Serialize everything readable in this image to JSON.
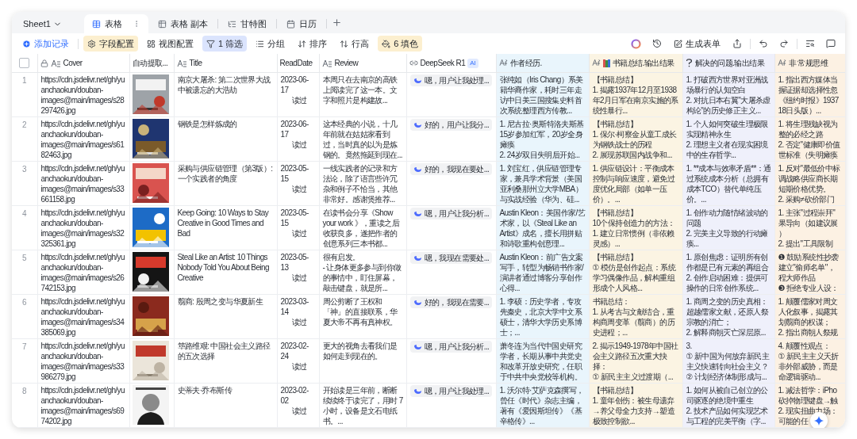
{
  "sheet": {
    "name": "Sheet1"
  },
  "tabs": [
    {
      "label": "表格",
      "selected": true
    },
    {
      "label": "表格 副本",
      "selected": false
    },
    {
      "label": "甘特图",
      "selected": false
    },
    {
      "label": "日历",
      "selected": false
    }
  ],
  "toolbar": [
    {
      "label": "添加记录",
      "kind": "primary"
    },
    {
      "label": "字段配置",
      "kind": "warm"
    },
    {
      "label": "视图配置",
      "kind": "plain"
    },
    {
      "label": "1 筛选",
      "kind": "cool"
    },
    {
      "label": "分组",
      "kind": "plain"
    },
    {
      "label": "排序",
      "kind": "plain"
    },
    {
      "label": "行高",
      "kind": "plain"
    },
    {
      "label": "6 填色",
      "kind": "warm"
    }
  ],
  "generate_form": {
    "label": "生成表单"
  },
  "table": {
    "header_checkbox": {
      "checked": false
    },
    "columns": [
      {
        "label": "Cover",
        "kind": "locked-text",
        "color": "#ffffff"
      },
      {
        "label": "自动提取...",
        "kind": "plain",
        "color": "#ffffff"
      },
      {
        "label": "Title",
        "kind": "text",
        "color": "#ffffff"
      },
      {
        "label": "ReadDate",
        "kind": "plain",
        "color": "#ffffff"
      },
      {
        "label": "Review",
        "kind": "text",
        "color": "#ffffff"
      },
      {
        "label": "DeepSeek  R1",
        "kind": "link",
        "badge": "AI",
        "color": "#ffffff"
      },
      {
        "label": "作者经历.",
        "kind": "ai-text",
        "color": "#e9f5fc"
      },
      {
        "label": "书籍总结.输出结果",
        "kind": "ai-book",
        "color": "#fbf4e3"
      },
      {
        "label": "解决的问题.输出结果",
        "kind": "question",
        "color": "#eff0fb"
      },
      {
        "label": "非 常规思维",
        "kind": "ai-text",
        "color": "#fcf1e3"
      }
    ],
    "rows": [
      {
        "number": "1",
        "cover_url": "https://cdn.jsdelivr.net/gh/yuanchaokun/douban-images@main/images/s28297426.jpg",
        "title": "南京大屠杀: 第二次世界大战中被遗忘的大浩劫",
        "read_date": "2023-06-17",
        "status": "读过",
        "review": "本周只在去南京的高铁上阅读完了这一本。文字和照片是构建故...",
        "deepseek": "嗯，用户让我处理...",
        "author": "张纯如（Iris Chang）系美籍华裔作家，耗时三年走访中日美三国搜集史料首次系统整理西方传教...",
        "summary": "【书籍总结】\n1. 揭露1937年12月至1938年2月日军在南京实施的系统性暴行...",
        "problems": "1. 打破西方世界对亚洲战场暴行的认知空白\n2. 对抗日本右翼\"大屠杀虚构论\"的历史修正主义...",
        "unusual": [
          "1. 指出西方媒体当",
          "握证据却选择性忽",
          "《纽约时报》1937",
          "18日头版）..."
        ]
      },
      {
        "number": "2",
        "cover_url": "https://cdn.jsdelivr.net/gh/yuanchaokun/douban-images@main/images/s6182463.jpg",
        "title": "钢铁是怎样炼成的",
        "read_date": "2023-06-17",
        "status": "读过",
        "review": "这本经典的小说，十几年前就在姑姑家看到过，当时真的以为是炼钢的。竟然拖延到现在...",
        "deepseek": "好的，用户让我分...",
        "author": "1. 尼古拉·奥斯特洛夫斯基15岁参加红军，20岁全身瘫痪\n2. 24岁双目失明后开始...",
        "summary": "【书籍总结】\n1. 保尔·柯察金从童工成长为钢铁战士的历程\n2. 展现苏联国内战争和...",
        "problems": "1. 个人如何突破生理极限实现精神永生\n2. 理想主义者在现实困境中的生存哲学...",
        "unusual": [
          "1. 将生理残缺视为",
          "整的必经之路",
          "2. 否定\"健康即价值",
          "世标准（失明瘫痪"
        ]
      },
      {
        "number": "3",
        "cover_url": "https://cdn.jsdelivr.net/gh/yuanchaokun/douban-images@main/images/s33661158.jpg",
        "title": "采购与供应链管理（第3版）:一个实践者的角度",
        "read_date": "2023-05-15",
        "status": "读过",
        "review": "一线实践者的记录和方法论，除了语言些许冗杂和例子不恰当，其他非常好。感谢煲推荐...",
        "deepseek": "好的，我现在要处...",
        "author": "1. 刘宝红，供应链管理专家，兼具学术背景（美国亚利桑那州立大学MBA）与实战经验（华为、硅...",
        "summary": "1. 供应链设计：平衡成本控制与响应速度，避免过度优化局部（如单一压价）。...",
        "problems": "1. **成本与效率矛盾**：通过系统成本分析（总拥有成本TCO）替代单纯压价。...",
        "unusual": [
          "1. 反对\"最低价中标",
          "调战略供应商长期",
          "短期价格优势。",
          "2. 采购≠砍价部门"
        ]
      },
      {
        "number": "4",
        "cover_url": "https://cdn.jsdelivr.net/gh/yuanchaokun/douban-images@main/images/s32325361.jpg",
        "title": "Keep Going: 10 Ways to Stay Creative in Good Times and Bad",
        "read_date": "2023-05-15",
        "status": "读过",
        "review": "在读书会分享《Show your work 》，重读之后收获良多，遂把作者的创意系列三本书都...",
        "deepseek": "嗯，用户让我分析...",
        "author": "Austin Kleon：美国作家/艺术家，以《Steal Like an Artist》成名，擅长用拼贴和诗歌重构创意理...",
        "summary": "【书籍总结】\n10个保持创造力的方法：\n1. 建立日常惯例（非依赖灵感）...",
        "problems": "1. 创作动力随情绪波动的问题\n2. 完美主义导致的行动瘫痪...",
        "unusual": [
          "1. 主张\"过程崇拜\"",
          "果导向（如建议展",
          "）",
          "2. 提出\"工具限制"
        ]
      },
      {
        "number": "5",
        "cover_url": "https://cdn.jsdelivr.net/gh/yuanchaokun/douban-images@main/images/s26742153.jpg",
        "title": "Steal Like an Artist: 10 Things Nobody Told You About Being Creative",
        "read_date": "2023-05-13",
        "status": "读过",
        "review": "很有启发。\n- 让身体更多参与到你做的事情中，盯住屏幕，敲击键盘，就是所...",
        "deepseek": "嗯，我现在需要处...",
        "author": "Austin Kleon：前广告文案写手，转型为畅销书作家/演讲者通过博客分享创作心得...",
        "summary": "【书籍总结】\n① 模仿是创作起点：系统学习偶像作品，解构重组形成个人风格...",
        "problems": "1. 原创焦虑：证明所有创作都是已有元素的再组合\n2. 创作启动困难：提供可操作的日常创作系统...",
        "unusual": [
          "❶ 鼓励系统性抄袭",
          "建立\"偷师名单\"，",
          "程大师作品",
          "❸ 拒绝专业人设："
        ]
      },
      {
        "number": "6",
        "cover_url": "https://cdn.jsdelivr.net/gh/yuanchaokun/douban-images@main/images/s34385069.jpg",
        "title": "翦商: 殷周之变与华夏新生",
        "read_date": "2023-03-14",
        "status": "读过",
        "review": "周公剪断了王权和「神」的直接联系，华夏大帝不再有真神权。",
        "deepseek": "好的，我现在需要...",
        "author": "1. 李硕：历史学者，专攻先秦史，北京大学中文系硕士，清华大学历史系博士；...",
        "summary": "书籍总结：\n1. 从考古与文献结合，重构商周变革（翦商）的历史进程；...",
        "problems": "1. 商周之变的历史真相：超越儒家文献，还原人祭宗教的消亡；\n2. 解释商朝灭亡深层原...",
        "unusual": [
          "1. 颠覆儒家对周文",
          "人化叙事，揭露其",
          "划翦商的权谋；",
          "2. 指出商朝人祭规"
        ]
      },
      {
        "number": "7",
        "cover_url": "https://cdn.jsdelivr.net/gh/yuanchaokun/douban-images@main/images/s33986279.jpg",
        "title": "筚路维艰: 中国社会主义路径的五次选择",
        "read_date": "2023-02-24",
        "status": "读过",
        "review": "更大的视角去看我们是如何走到现在的。",
        "deepseek": "嗯，用户让我分析...",
        "author": "萧冬连为当代中国史研究学者，长期从事中共党史和改革开放史研究，任职于中共中央党校等机构。",
        "summary": "2. 揭示1949-1978年中国社会主义路径五次重大抉择：\n① 新民主主义过渡期（...",
        "problems": "3.\n① 新中国为何放弃新民主主义快速转向社会主义？\n② 计划经济体制形成与...",
        "unusual": [
          "4. 颠覆性观点：",
          "① 新民主主义夭折",
          "非外部威胁，而是",
          "命逻辑驱动..."
        ]
      },
      {
        "number": "8",
        "cover_url": "https://cdn.jsdelivr.net/gh/yuanchaokun/douban-images@main/images/s6974202.jpg",
        "title": "史蒂夫·乔布斯传",
        "read_date": "2023-02-02",
        "status": "读过",
        "review": "开始读是三年前，断断续续终于读完了，用时 7 小时，设备是文石电纸书。...",
        "deepseek": "嗯，用户让我处理...",
        "author": "1. 沃尔特·艾萨克森撰写，曾任《时代》杂志主编，著有《爱因斯坦传》《基辛格传》...",
        "summary": "【书籍总结】\n1. 童年创伤：被生母遗弃→养父母全力支持→塑造极致控制欲...",
        "problems": "1. 如何从被自己创立的公司驱逐的绝境中重生\n2. 技术产品如何实现艺术与工程的完美平衡（字...",
        "unusual": [
          "1. 减法哲学：iPho",
          "砍掉物理键盘→触",
          "2. 现实扭曲力场：",
          "可能的任"
        ]
      }
    ]
  }
}
